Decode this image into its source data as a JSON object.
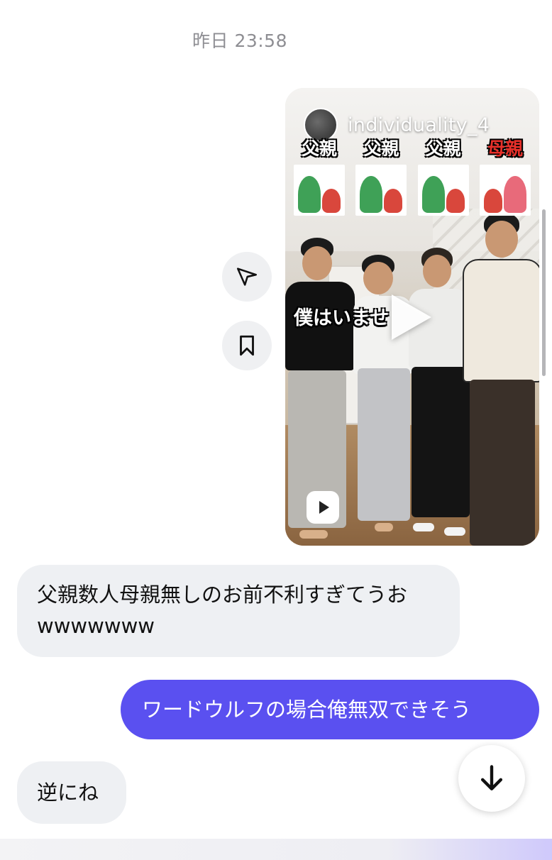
{
  "thread": {
    "timestamp": "昨日 23:58"
  },
  "shared_reel": {
    "username": "individuality_4",
    "roles": [
      {
        "label": "父親",
        "type": "father"
      },
      {
        "label": "父親",
        "type": "father"
      },
      {
        "label": "父親",
        "type": "father"
      },
      {
        "label": "母親",
        "type": "mother"
      }
    ],
    "caption": "僕はいませ",
    "icons": {
      "play": "play-icon",
      "reel": "reel-icon"
    }
  },
  "actions": {
    "share_icon": "send-icon",
    "save_icon": "bookmark-icon"
  },
  "messages": [
    {
      "direction": "incoming",
      "text": "父親数人母親無しのお前不利すぎてうおwwwwwww"
    },
    {
      "direction": "outgoing",
      "text": "ワードウルフの場合俺無双できそう"
    },
    {
      "direction": "incoming",
      "text": "逆にね"
    }
  ],
  "scroll_button": {
    "icon": "arrow-down-icon"
  },
  "colors": {
    "outgoing_bubble": "#5a50f0",
    "incoming_bubble": "#eef0f3",
    "mother_label": "#e8302a"
  }
}
